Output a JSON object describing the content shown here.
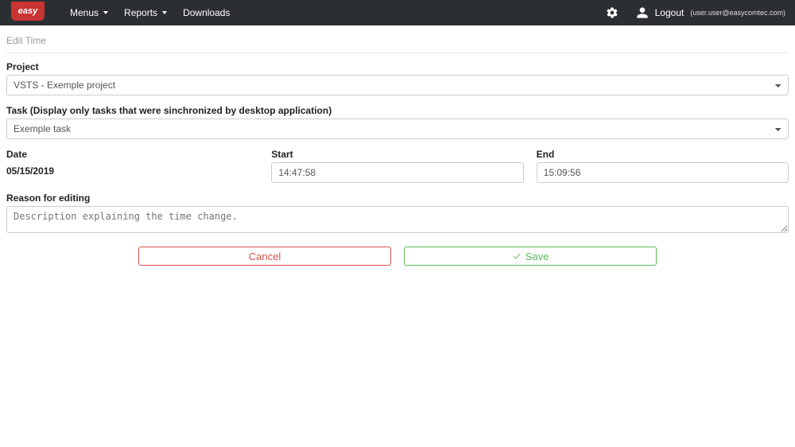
{
  "logo_text": "easy",
  "nav": {
    "menus": "Menus",
    "reports": "Reports",
    "downloads": "Downloads",
    "logout": "Logout",
    "user_email": "(user.user@easycomtec.com)"
  },
  "page": {
    "title": "Edit Time"
  },
  "form": {
    "project_label": "Project",
    "project_value": "VSTS - Exemple project",
    "task_label": "Task (Display only tasks that were sinchronized by desktop application)",
    "task_value": "Exemple task",
    "date_label": "Date",
    "date_value": "05/15/2019",
    "start_label": "Start",
    "start_value": "14:47:58",
    "end_label": "End",
    "end_value": "15:09:56",
    "reason_label": "Reason for editing",
    "reason_placeholder": "Description explaining the time change."
  },
  "buttons": {
    "cancel": "Cancel",
    "save": "Save"
  }
}
